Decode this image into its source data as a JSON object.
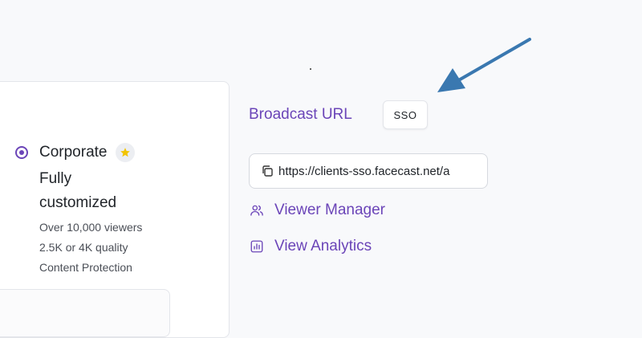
{
  "plan": {
    "name": "Corporate",
    "star_icon": "star-icon",
    "subtitle": "Fully customized",
    "features": [
      "Over 10,000 viewers",
      "2.5K or 4K quality",
      "Content Protection"
    ]
  },
  "broadcast": {
    "label": "Broadcast URL",
    "badge": "SSO",
    "url": "https://clients-sso.facecast.net/a"
  },
  "links": {
    "viewer_manager": "Viewer Manager",
    "view_analytics": "View Analytics"
  },
  "colors": {
    "accent": "#6b45b8",
    "arrow": "#3a78b0",
    "star": "#f2c400"
  }
}
